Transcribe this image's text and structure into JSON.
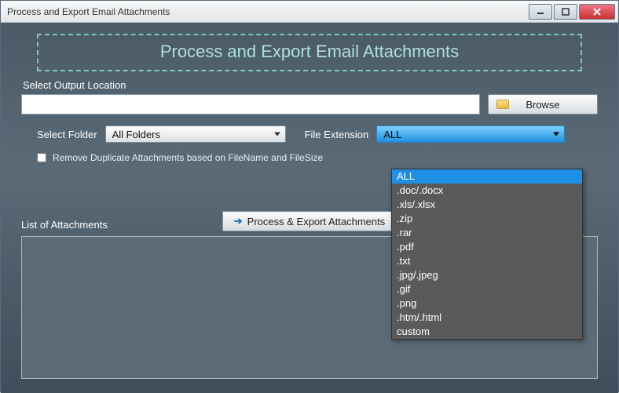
{
  "window": {
    "title": "Process and Export Email Attachments"
  },
  "banner": {
    "title": "Process and Export Email Attachments"
  },
  "output": {
    "label": "Select Output Location",
    "value": "",
    "browse_label": "Browse"
  },
  "folder": {
    "label": "Select Folder",
    "value": "All Folders"
  },
  "extension": {
    "label": "File Extension",
    "value": "ALL",
    "options": [
      "ALL",
      ".doc/.docx",
      ".xls/.xlsx",
      ".zip",
      ".rar",
      ".pdf",
      ".txt",
      ".jpg/.jpeg",
      ".gif",
      ".png",
      ".htm/.html",
      "custom"
    ]
  },
  "dedupe": {
    "label": "Remove Duplicate Attachments based  on FileName and FileSize",
    "checked": false
  },
  "process": {
    "label": "Process & Export Attachments"
  },
  "list": {
    "label": "List of Attachments"
  }
}
